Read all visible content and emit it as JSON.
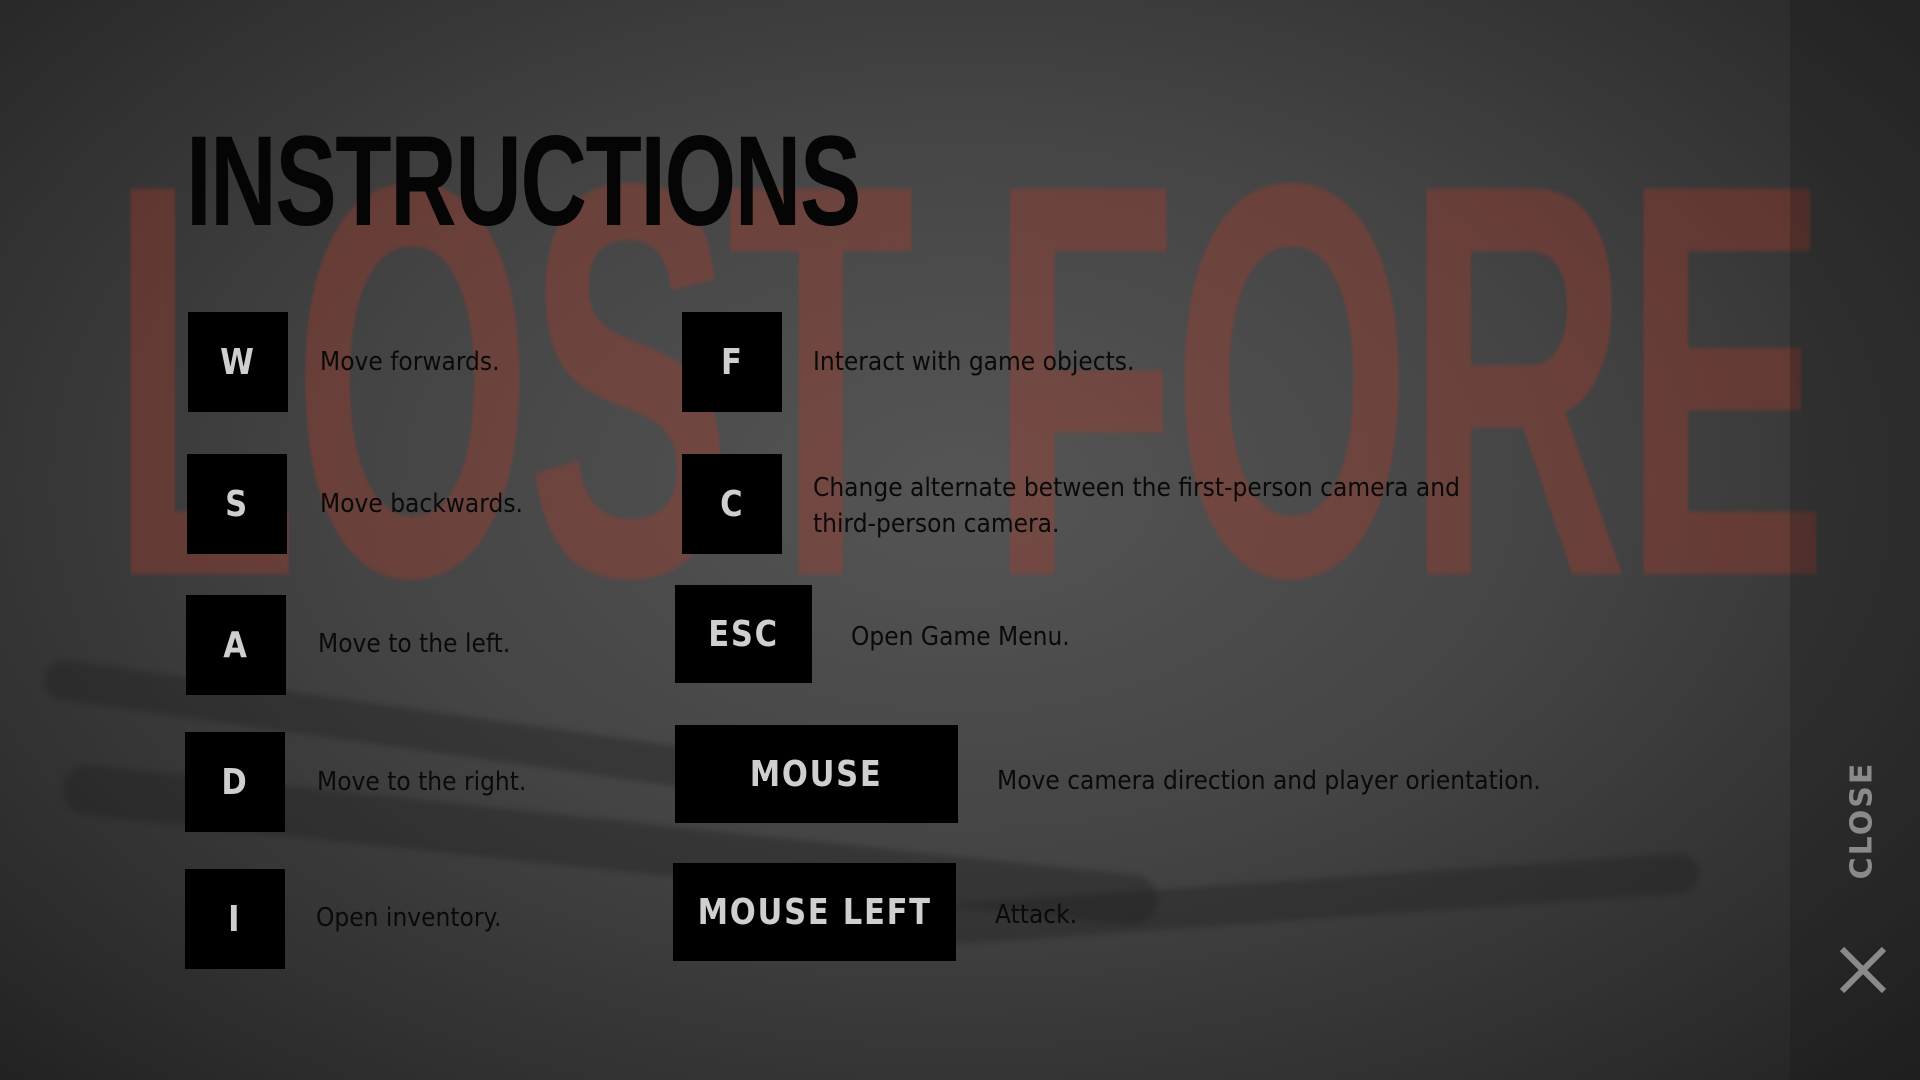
{
  "background_logo": "LOST FOREST",
  "title": "INSTRUCTIONS",
  "left_bindings": [
    {
      "key": "W",
      "description": "Move forwards."
    },
    {
      "key": "S",
      "description": "Move backwards."
    },
    {
      "key": "A",
      "description": "Move to the left."
    },
    {
      "key": "D",
      "description": "Move to the right."
    },
    {
      "key": "I",
      "description": "Open inventory."
    }
  ],
  "right_bindings": [
    {
      "key": "F",
      "description": "Interact with game objects."
    },
    {
      "key": "C",
      "description_line1": "Change alternate between the first-person camera and",
      "description_line2": "third-person camera."
    },
    {
      "key": "ESC",
      "description": "Open Game Menu."
    },
    {
      "key": "MOUSE",
      "description": "Move camera direction and player orientation."
    },
    {
      "key": "MOUSE LEFT",
      "description": "Attack."
    }
  ],
  "close": {
    "label": "CLOSE",
    "icon": "close-x-icon"
  },
  "colors": {
    "key_bg": "#000000",
    "key_text": "#cfcfcf",
    "close": "#8a8a8a"
  }
}
